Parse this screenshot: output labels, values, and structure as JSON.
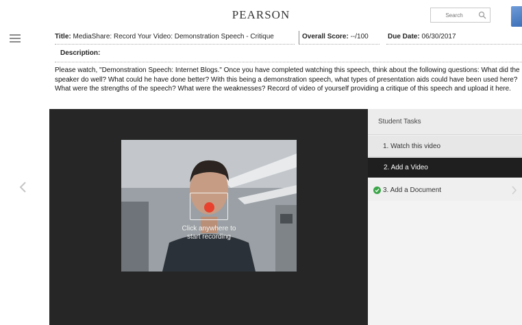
{
  "header": {
    "brand": "PEARSON",
    "search_placeholder": "Search"
  },
  "assignment": {
    "title_label": "Title:",
    "title_value": "MediaShare: Record Your Video: Demonstration Speech - Critique",
    "score_label": "Overall Score:",
    "score_value": "--/100",
    "due_label": "Due Date:",
    "due_value": "06/30/2017",
    "description_label": "Description:",
    "description_text": "Please watch, \"Demonstration Speech: Internet Blogs.\" Once you have completed watching this speech, think about the following questions: What did the speaker do well? What could he have done better? With this being a demonstration speech, what types of presentation aids could have been used here? What were the strengths of the speech? What were the weaknesses? Record of video of yourself providing a critique of this speech and upload it here."
  },
  "recorder": {
    "hint_line1": "Click anywhere to",
    "hint_line2": "start recording",
    "record_color": "#e8412d"
  },
  "tasks": {
    "header": "Student Tasks",
    "items": [
      {
        "label": "1. Watch this video",
        "state": "default"
      },
      {
        "label": "2. Add a Video",
        "state": "active"
      },
      {
        "label": "3. Add a Document",
        "state": "completed",
        "icon": "check-icon"
      }
    ],
    "active_color": "#1f1f1f",
    "completed_color": "#3aa548"
  }
}
